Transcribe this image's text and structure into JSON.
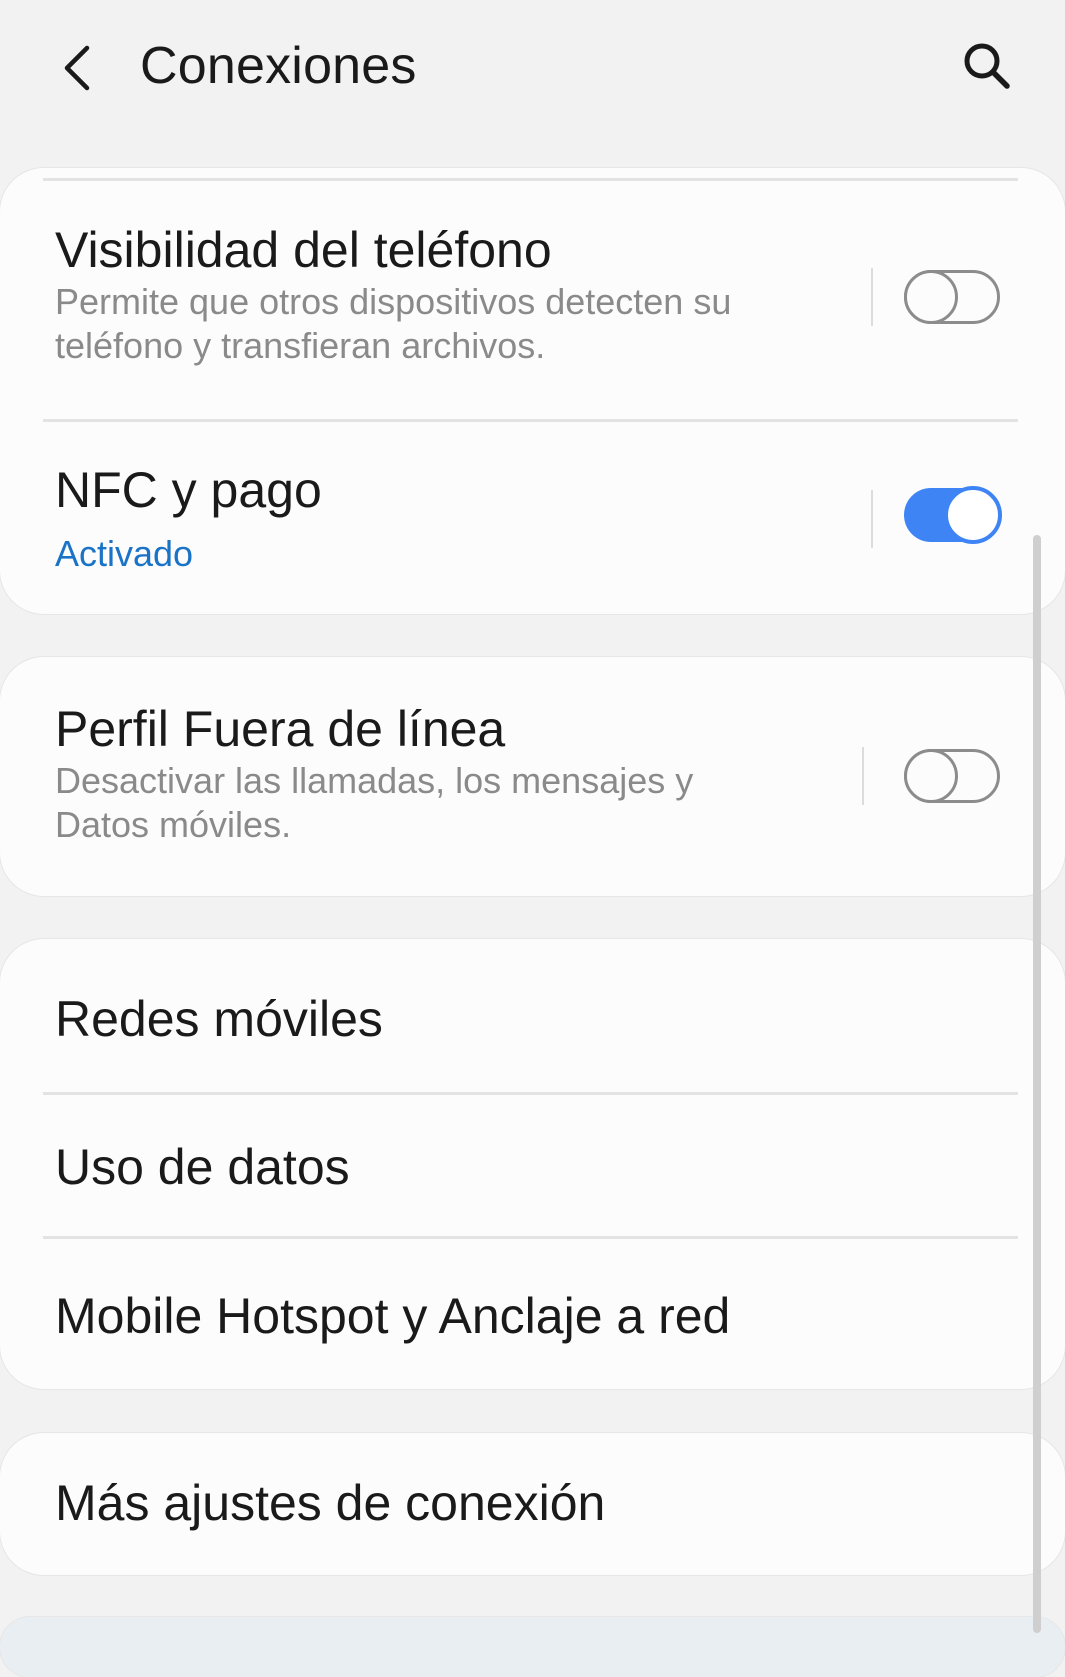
{
  "header": {
    "title": "Conexiones",
    "back_icon": "chevron-left-icon",
    "search_icon": "search-icon"
  },
  "settings": {
    "visibility": {
      "title": "Visibilidad del teléfono",
      "subtitle": "Permite que otros dispositivos detecten su teléfono y transfieran archivos.",
      "enabled": false
    },
    "nfc": {
      "title": "NFC y pago",
      "status": "Activado",
      "enabled": true
    },
    "offline": {
      "title": "Perfil Fuera de línea",
      "subtitle": "Desactivar las llamadas, los mensajes y Datos móviles.",
      "enabled": false
    },
    "mobile_networks": {
      "title": "Redes móviles"
    },
    "data_usage": {
      "title": "Uso de datos"
    },
    "hotspot": {
      "title": "Mobile Hotspot y Anclaje a red"
    },
    "more": {
      "title": "Más ajustes de conexión"
    }
  },
  "colors": {
    "accent": "#3e84f5",
    "status_text": "#1a73c7",
    "background": "#f2f2f2",
    "card": "#fcfcfc"
  }
}
